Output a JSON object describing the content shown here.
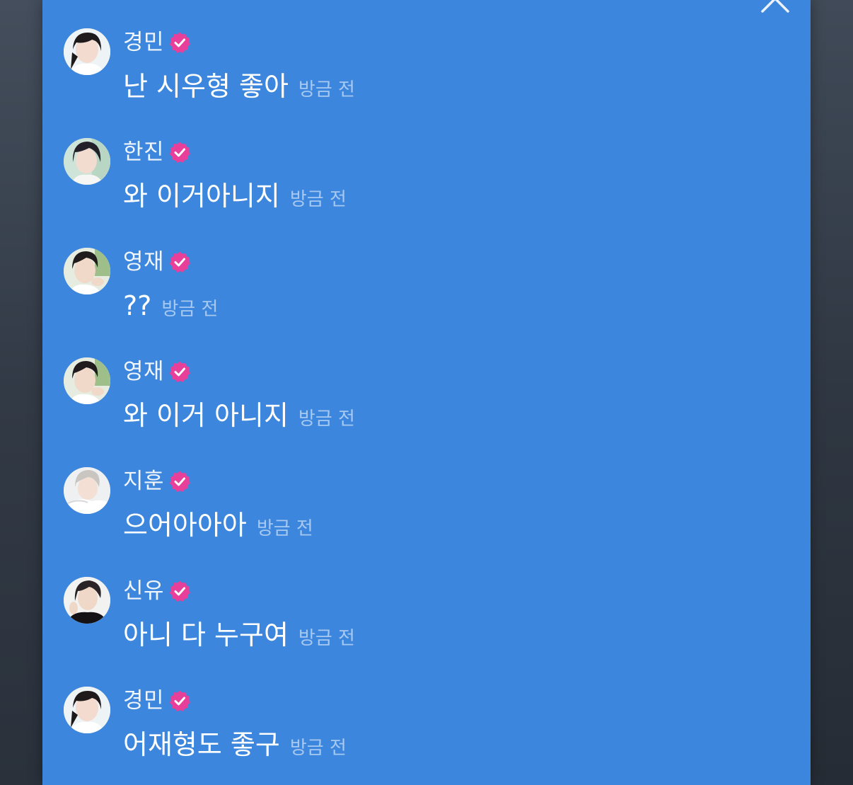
{
  "chat": {
    "messages": [
      {
        "name": "경민",
        "text": "난 시우형 좋아",
        "time": "방금 전",
        "avatar": "avatar-kyungmin"
      },
      {
        "name": "한진",
        "text": "와 이거아니지",
        "time": "방금 전",
        "avatar": "avatar-hanjin"
      },
      {
        "name": "영재",
        "text": "??",
        "time": "방금 전",
        "avatar": "avatar-youngjae"
      },
      {
        "name": "영재",
        "text": "와 이거 아니지",
        "time": "방금 전",
        "avatar": "avatar-youngjae"
      },
      {
        "name": "지훈",
        "text": "으어아아아",
        "time": "방금 전",
        "avatar": "avatar-jihoon"
      },
      {
        "name": "신유",
        "text": "아니 다 누구여",
        "time": "방금 전",
        "avatar": "avatar-shinyu"
      },
      {
        "name": "경민",
        "text": "어재형도 좋구",
        "time": "방금 전",
        "avatar": "avatar-kyungmin"
      }
    ]
  },
  "icons": {
    "collapse": "chevron-up-icon",
    "verified": "verified-badge-icon"
  },
  "colors": {
    "panel_bg": "#3c86dd",
    "badge": "#e8409a",
    "text": "#ffffff"
  }
}
